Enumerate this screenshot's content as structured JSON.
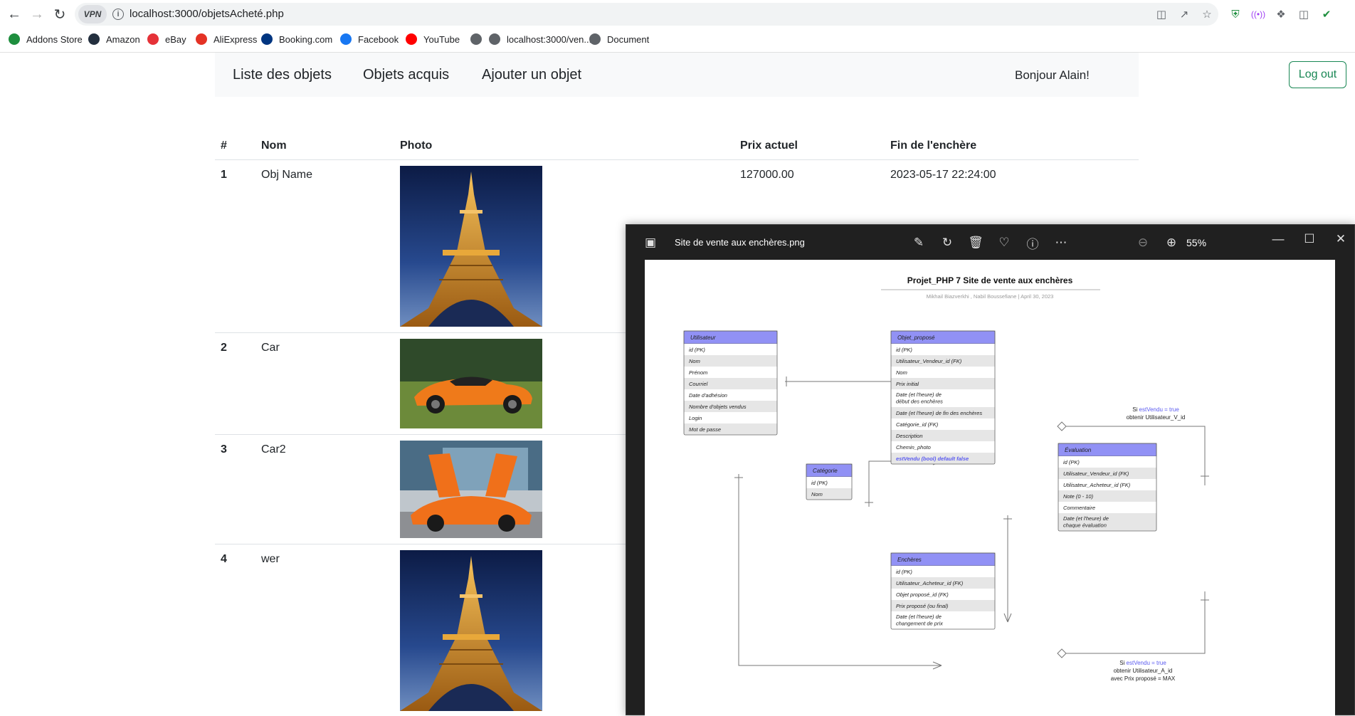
{
  "browser": {
    "vpn_label": "VPN",
    "url": "localhost:3000/objetsAcheté.php",
    "bookmarks": [
      {
        "label": "Addons Store",
        "icon": "addons-store-icon",
        "color": "#1e8e3e"
      },
      {
        "label": "Amazon",
        "icon": "amazon-icon",
        "color": "#232f3e"
      },
      {
        "label": "eBay",
        "icon": "ebay-icon",
        "color": "#e53238"
      },
      {
        "label": "AliExpress",
        "icon": "aliexpress-icon",
        "color": "#e43225"
      },
      {
        "label": "Booking.com",
        "icon": "booking-icon",
        "color": "#003580"
      },
      {
        "label": "Facebook",
        "icon": "facebook-icon",
        "color": "#1877f2"
      },
      {
        "label": "YouTube",
        "icon": "youtube-icon",
        "color": "#ff0000"
      },
      {
        "label": "",
        "icon": "globe-icon",
        "color": "#5f6368"
      },
      {
        "label": "localhost:3000/ven...",
        "icon": "globe-icon",
        "color": "#5f6368"
      },
      {
        "label": "Document",
        "icon": "globe-icon",
        "color": "#5f6368"
      }
    ]
  },
  "navbar": {
    "links": [
      "Liste des objets",
      "Objets acquis",
      "Ajouter un objet"
    ],
    "greeting": "Bonjour Alain!",
    "logout": "Log out",
    "accent_color": "#198754"
  },
  "table": {
    "headers": [
      "#",
      "Nom",
      "Photo",
      "Prix actuel",
      "Fin de l'enchère"
    ],
    "rows": [
      {
        "num": "1",
        "name": "Obj Name",
        "photo": "eiffel-tower-photo",
        "price": "127000.00",
        "end": "2023-05-17 22:24:00"
      },
      {
        "num": "2",
        "name": "Car",
        "photo": "orange-supercar-photo",
        "price": "",
        "end": ""
      },
      {
        "num": "3",
        "name": "Car2",
        "photo": "orange-mclaren-photo",
        "price": "",
        "end": ""
      },
      {
        "num": "4",
        "name": "wer",
        "photo": "eiffel-tower-photo",
        "price": "",
        "end": ""
      }
    ]
  },
  "viewer": {
    "title": "Site de vente aux enchères.png",
    "zoom": "55%",
    "diagram": {
      "title": "Projet_PHP 7 Site de vente aux enchères",
      "subtitle": "Mikhail Biazverkhi , Nabil Boussefiane  |  April 30, 2023",
      "entities": {
        "utilisateur": {
          "name": "Utilisateur",
          "fields": [
            "id (PK)",
            "Nom",
            "Prénom",
            "Courriel",
            "Date d'adhésion",
            "Nombre d'objets vendus",
            "Login",
            "Mot de passe"
          ]
        },
        "objet": {
          "name": "Objet_proposé",
          "fields": [
            "id (PK)",
            "Utilisateur_Vendeur_id (FK)",
            "Nom",
            "Prix initial",
            "Date (et l'heure) de début des enchères",
            "Date (et l'heure) de fin des enchères",
            "Catégorie_id (FK)",
            "Description",
            "Chemin_photo",
            "estVendu (bool) default false"
          ]
        },
        "categorie": {
          "name": "Catégorie",
          "fields": [
            "id (PK)",
            "Nom"
          ]
        },
        "evaluation": {
          "name": "Évaluation",
          "fields": [
            "id (PK)",
            "Utilisateur_Vendeur_id (FK)",
            "Utilisateur_Acheteur_id (FK)",
            "Note (0 - 10)",
            "Commentaire",
            "Date (et l'heure) de chaque évaluation"
          ]
        },
        "encheres": {
          "name": "Enchères",
          "fields": [
            "id (PK)",
            "Utilisateur_Acheteur_id (FK)",
            "Objet proposé_id (FK)",
            "Prix proposé (ou final)",
            "Date (et l'heure) de changement de prix"
          ]
        }
      },
      "notes": {
        "note1": {
          "si": "Si ",
          "cond": "estVendu = true",
          "line2": "obtenir Utilisateur_V_id"
        },
        "note2": {
          "si": "Si ",
          "cond": "estVendu = true",
          "line2": "obtenir Utilisateur_A_id",
          "line3": "avec Prix proposé = MAX"
        }
      },
      "header_color": "#9191f5",
      "alt_row_color": "#e6e6e6",
      "highlight_color": "#5b5bf0"
    }
  }
}
